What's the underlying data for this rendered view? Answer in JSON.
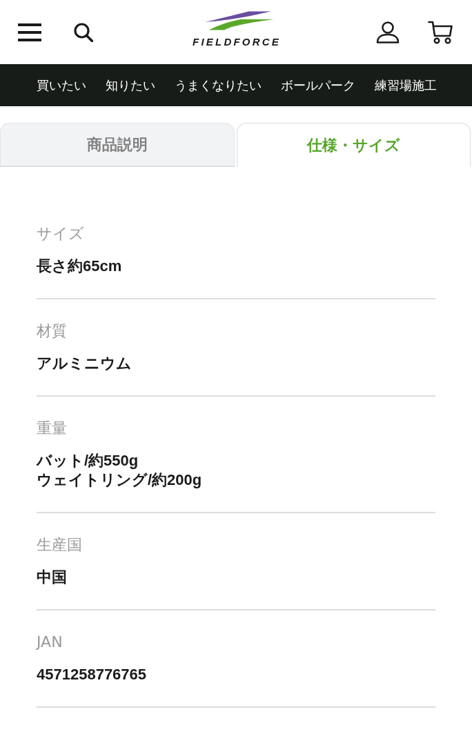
{
  "header": {
    "logo_text": "FIELDFORCE"
  },
  "nav": [
    "買いたい",
    "知りたい",
    "うまくなりたい",
    "ボールパーク",
    "練習場施工"
  ],
  "tabs": [
    {
      "label": "商品説明",
      "selected": false
    },
    {
      "label": "仕様・サイズ",
      "selected": true
    }
  ],
  "specs": [
    {
      "label": "サイズ",
      "lines": [
        "長さ約65cm"
      ]
    },
    {
      "label": "材質",
      "lines": [
        "アルミニウム"
      ]
    },
    {
      "label": "重量",
      "lines": [
        "バット/約550g",
        "ウェイトリング/約200g"
      ]
    },
    {
      "label": "生産国",
      "lines": [
        "中国"
      ]
    },
    {
      "label": "JAN",
      "lines": [
        "4571258776765"
      ]
    }
  ]
}
